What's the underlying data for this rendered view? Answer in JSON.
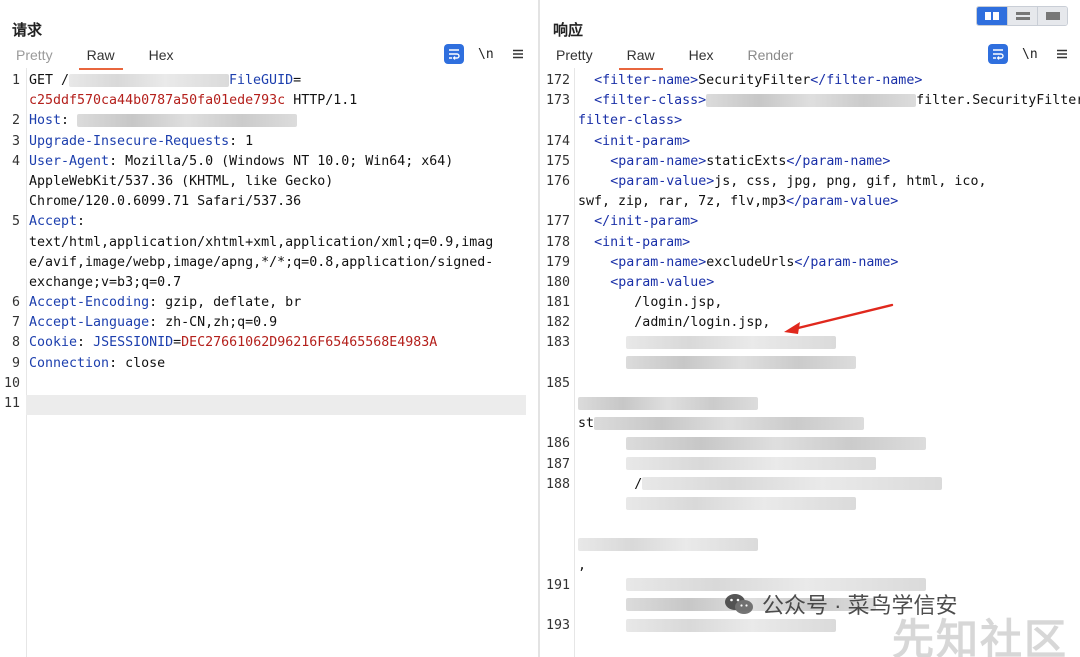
{
  "request": {
    "title": "请求",
    "tabs": [
      "Pretty",
      "Raw",
      "Hex"
    ],
    "active_tab": "Raw",
    "newline_label": "\\n",
    "lines": [
      {
        "n": "1",
        "parts": [
          [
            "",
            "GET /"
          ],
          [
            "blur",
            ""
          ],
          [
            "k",
            "FileGUID"
          ],
          [
            "",
            "="
          ]
        ]
      },
      {
        "n": "",
        "parts": [
          [
            "v",
            "c25ddf570ca44b0787a50fa01ede793c"
          ],
          [
            "",
            " HTTP/1.1"
          ]
        ]
      },
      {
        "n": "2",
        "parts": [
          [
            "k",
            "Host"
          ],
          [
            "",
            ": "
          ],
          [
            "blur",
            ""
          ]
        ]
      },
      {
        "n": "3",
        "parts": [
          [
            "k",
            "Upgrade-Insecure-Requests"
          ],
          [
            "",
            ": 1"
          ]
        ]
      },
      {
        "n": "4",
        "parts": [
          [
            "k",
            "User-Agent"
          ],
          [
            "",
            ": Mozilla/5.0 (Windows NT 10.0; Win64; x64)"
          ]
        ]
      },
      {
        "n": "",
        "parts": [
          [
            "",
            "AppleWebKit/537.36 (KHTML, like Gecko)"
          ]
        ]
      },
      {
        "n": "",
        "parts": [
          [
            "",
            "Chrome/120.0.6099.71 Safari/537.36"
          ]
        ]
      },
      {
        "n": "5",
        "parts": [
          [
            "k",
            "Accept"
          ],
          [
            "",
            ":"
          ]
        ]
      },
      {
        "n": "",
        "parts": [
          [
            "",
            "text/html,application/xhtml+xml,application/xml;q=0.9,imag"
          ]
        ]
      },
      {
        "n": "",
        "parts": [
          [
            "",
            "e/avif,image/webp,image/apng,*/*;q=0.8,application/signed-"
          ]
        ]
      },
      {
        "n": "",
        "parts": [
          [
            "",
            "exchange;v=b3;q=0.7"
          ]
        ]
      },
      {
        "n": "6",
        "parts": [
          [
            "k",
            "Accept-Encoding"
          ],
          [
            "",
            ": gzip, deflate, br"
          ]
        ]
      },
      {
        "n": "7",
        "parts": [
          [
            "k",
            "Accept-Language"
          ],
          [
            "",
            ": zh-CN,zh;q=0.9"
          ]
        ]
      },
      {
        "n": "8",
        "parts": [
          [
            "k",
            "Cookie"
          ],
          [
            "",
            ": "
          ],
          [
            "k",
            "JSESSIONID"
          ],
          [
            "",
            "="
          ],
          [
            "v",
            "DEC27661062D96216F65465568E4983A"
          ]
        ]
      },
      {
        "n": "9",
        "parts": [
          [
            "k",
            "Connection"
          ],
          [
            "",
            ": close"
          ]
        ]
      },
      {
        "n": "10",
        "parts": []
      },
      {
        "n": "11",
        "parts": []
      }
    ]
  },
  "response": {
    "title": "响应",
    "tabs": [
      "Pretty",
      "Raw",
      "Hex",
      "Render"
    ],
    "active_tab": "Raw",
    "newline_label": "\\n",
    "lines": [
      {
        "n": "172",
        "indent": 2,
        "parts": [
          [
            "tag",
            "<filter-name>"
          ],
          [
            "",
            "SecurityFilter"
          ],
          [
            "tag",
            "</filter-name>"
          ]
        ]
      },
      {
        "n": "173",
        "indent": 2,
        "parts": [
          [
            "tag",
            "<filter-class>"
          ],
          [
            "blur",
            ""
          ],
          [
            "",
            "filter.SecurityFilter"
          ],
          [
            "tag",
            "</"
          ]
        ]
      },
      {
        "n": "",
        "indent": 0,
        "parts": [
          [
            "tag",
            "filter-class>"
          ]
        ]
      },
      {
        "n": "174",
        "indent": 2,
        "parts": [
          [
            "tag",
            "<init-param>"
          ]
        ]
      },
      {
        "n": "175",
        "indent": 4,
        "parts": [
          [
            "tag",
            "<param-name>"
          ],
          [
            "",
            "staticExts"
          ],
          [
            "tag",
            "</param-name>"
          ]
        ]
      },
      {
        "n": "176",
        "indent": 4,
        "parts": [
          [
            "tag",
            "<param-value>"
          ],
          [
            "",
            "js, css, jpg, png, gif, html, ico,"
          ]
        ]
      },
      {
        "n": "",
        "indent": 0,
        "parts": [
          [
            "",
            "swf, zip, rar, 7z, flv,mp3"
          ],
          [
            "tag",
            "</param-value>"
          ]
        ]
      },
      {
        "n": "177",
        "indent": 2,
        "parts": [
          [
            "tag",
            "</init-param>"
          ]
        ]
      },
      {
        "n": "178",
        "indent": 2,
        "parts": [
          [
            "tag",
            "<init-param>"
          ]
        ]
      },
      {
        "n": "179",
        "indent": 4,
        "parts": [
          [
            "tag",
            "<param-name>"
          ],
          [
            "",
            "excludeUrls"
          ],
          [
            "tag",
            "</param-name>"
          ]
        ]
      },
      {
        "n": "180",
        "indent": 4,
        "parts": [
          [
            "tag",
            "<param-value>"
          ]
        ]
      },
      {
        "n": "181",
        "indent": 6,
        "parts": [
          [
            "",
            " /login.jsp,"
          ]
        ]
      },
      {
        "n": "182",
        "indent": 6,
        "parts": [
          [
            "",
            " /admin/login.jsp,"
          ]
        ]
      },
      {
        "n": "183",
        "indent": 6,
        "parts": [
          [
            "blur",
            ""
          ]
        ]
      },
      {
        "n": "",
        "indent": 6,
        "parts": [
          [
            "blur",
            ""
          ]
        ]
      },
      {
        "n": "185",
        "indent": 0,
        "parts": []
      },
      {
        "n": "",
        "indent": 0,
        "parts": [
          [
            "blur",
            ""
          ]
        ]
      },
      {
        "n": "",
        "indent": 0,
        "parts": [
          [
            "",
            "st"
          ],
          [
            "blur",
            ""
          ]
        ]
      },
      {
        "n": "186",
        "indent": 6,
        "parts": [
          [
            "blur",
            ""
          ]
        ]
      },
      {
        "n": "187",
        "indent": 6,
        "parts": [
          [
            "blur",
            ""
          ]
        ]
      },
      {
        "n": "188",
        "indent": 6,
        "parts": [
          [
            "",
            " /"
          ],
          [
            "blur",
            ""
          ]
        ]
      },
      {
        "n": "",
        "indent": 6,
        "parts": [
          [
            "blur",
            ""
          ]
        ]
      },
      {
        "n": "",
        "indent": 0,
        "parts": []
      },
      {
        "n": "",
        "indent": 0,
        "parts": [
          [
            "blur",
            ""
          ]
        ]
      },
      {
        "n": "",
        "indent": 0,
        "parts": [
          [
            "",
            ","
          ]
        ]
      },
      {
        "n": "191",
        "indent": 6,
        "parts": [
          [
            "blur",
            ""
          ]
        ]
      },
      {
        "n": "",
        "indent": 6,
        "parts": [
          [
            "blur",
            ""
          ]
        ]
      },
      {
        "n": "193",
        "indent": 6,
        "parts": [
          [
            "blur",
            ""
          ]
        ]
      }
    ]
  },
  "watermark": {
    "text": "公众号 · 菜鸟学信安",
    "big_text": "先知社区"
  },
  "colors": {
    "accent": "#e8663d",
    "primary_button": "#2f6fde",
    "header_key": "#1d3fae",
    "header_value": "#b4201c",
    "arrow": "#e0281d"
  },
  "icons": {
    "word_wrap": "word-wrap-icon",
    "menu": "hamburger-menu-icon",
    "layout_split": "split-horizontal-icon",
    "layout_stack": "split-vertical-icon",
    "layout_single": "single-pane-icon"
  }
}
